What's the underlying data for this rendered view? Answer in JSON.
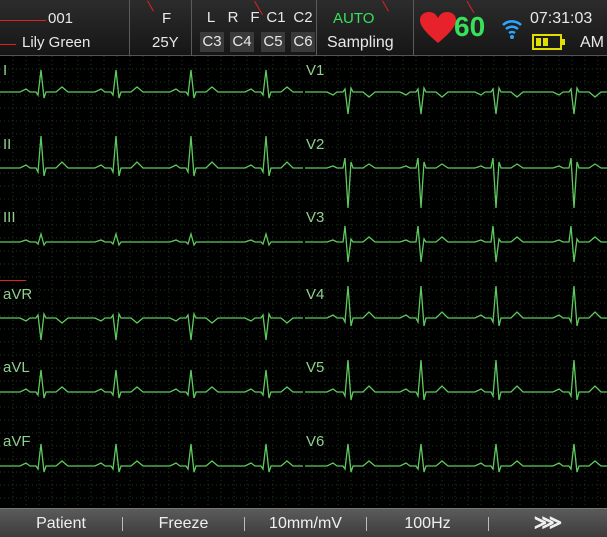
{
  "status": {
    "patient_id": "001",
    "patient_name": "Lily  Green",
    "sex": "F",
    "age": "25Y",
    "leads_row1": [
      "L",
      "R",
      "F",
      "C1",
      "C2"
    ],
    "leads_row2": [
      "C3",
      "C4",
      "C5",
      "C6"
    ],
    "mode": "AUTO",
    "state": "Sampling",
    "heart_rate": "60",
    "time": "07:31:03",
    "ampm": "AM"
  },
  "leads": {
    "left": [
      "I",
      "II",
      "III",
      "aVR",
      "aVL",
      "aVF"
    ],
    "right": [
      "V1",
      "V2",
      "V3",
      "V4",
      "V5",
      "V6"
    ]
  },
  "bottom": {
    "patient": "Patient",
    "freeze": "Freeze",
    "gain": "10mm/mV",
    "filter": "100Hz",
    "more": "⋙"
  },
  "colors": {
    "trace": "#5fc95f",
    "grid": "#1b3a1b",
    "heart": "#e8222a",
    "hr_text": "#39e05a",
    "wifi": "#2aa8ff",
    "battery": "#e0e000",
    "mode_text": "#39e05a"
  },
  "icons": {
    "heart": "heart-icon",
    "wifi": "wifi-icon",
    "battery": "battery-icon"
  }
}
